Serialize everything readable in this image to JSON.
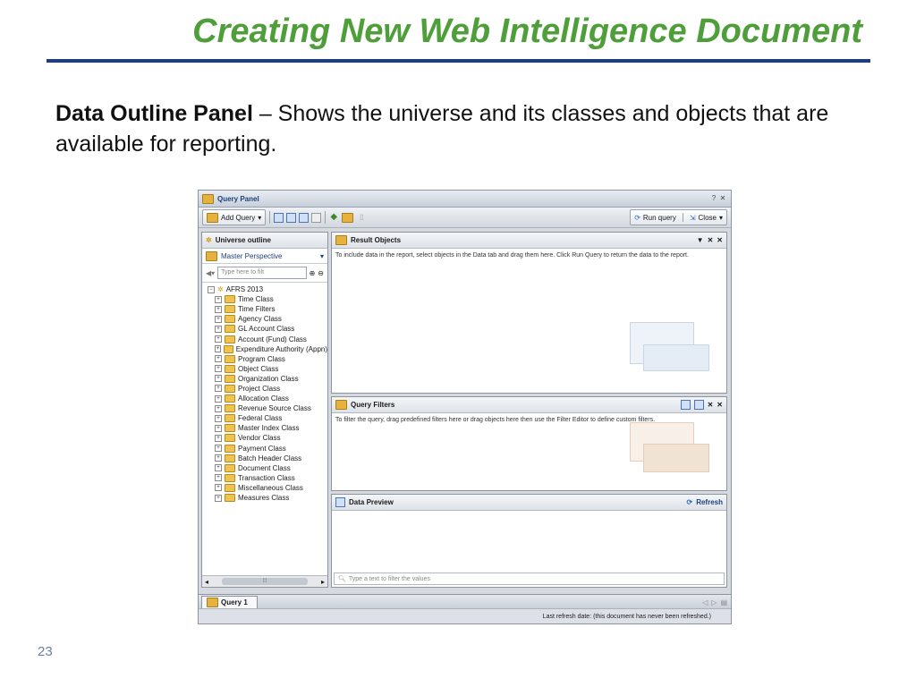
{
  "slide": {
    "title": "Creating New Web Intelligence Document",
    "lead_bold": "Data Outline Panel",
    "lead_rest": " – Shows the universe and its classes and objects that are available for reporting.",
    "page_number": "23"
  },
  "app": {
    "window_title": "Query Panel",
    "toolbar": {
      "add_query_label": "Add Query",
      "run_query_label": "Run query",
      "close_label": "Close"
    },
    "outline": {
      "title": "Universe outline",
      "perspective": "Master Perspective",
      "filter_placeholder": "Type here to filt",
      "universe_name": "AFRS 2013",
      "classes": [
        "Time Class",
        "Time Filters",
        "Agency Class",
        "GL Account Class",
        "Account (Fund) Class",
        "Expenditure Authority (Appn)",
        "Program Class",
        "Object Class",
        "Organization Class",
        "Project Class",
        "Allocation Class",
        "Revenue Source Class",
        "Federal Class",
        "Master Index Class",
        "Vendor Class",
        "Payment Class",
        "Batch Header Class",
        "Document Class",
        "Transaction Class",
        "Miscellaneous Class",
        "Measures Class"
      ]
    },
    "result_objects": {
      "title": "Result Objects",
      "hint": "To include data in the report, select objects in the Data tab and drag them here. Click Run Query to return the data to the report."
    },
    "query_filters": {
      "title": "Query Filters",
      "hint": "To filter the query, drag predefined filters here or drag objects here then use the Filter Editor to define custom filters."
    },
    "data_preview": {
      "title": "Data Preview",
      "refresh_label": "Refresh",
      "filter_placeholder": "Type a text to filter the values"
    },
    "tab_label": "Query 1",
    "status": "Last refresh date: (this document has never been refreshed.)"
  }
}
